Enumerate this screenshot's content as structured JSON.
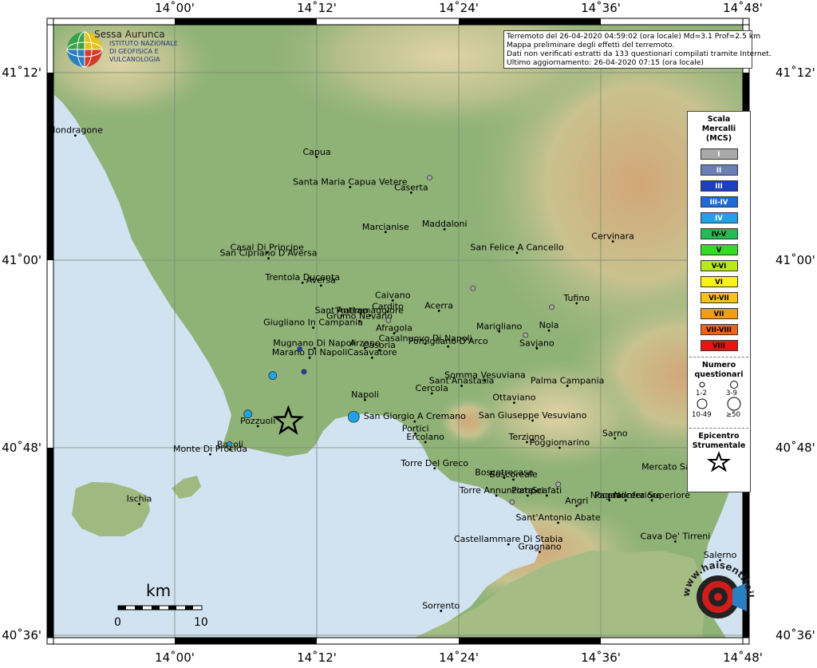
{
  "map": {
    "lon_ticks": [
      "14˚00'",
      "14˚12'",
      "14˚24'",
      "14˚36'",
      "14˚48'"
    ],
    "lat_ticks": [
      "41˚12'",
      "41˚00'",
      "40˚48'",
      "40˚36'"
    ],
    "colors": {
      "sea": "#d1e3f1",
      "lowland": "#8fb277",
      "hill": "#c3c08e",
      "mountain": "#cf9c70",
      "grid": "#7a8a7a"
    }
  },
  "logo": {
    "place": "Sessa Aurunca",
    "org_line1": "ISTITUTO NAZIONALE",
    "org_line2": "DI GEOFISICA E VULCANOLOGIA"
  },
  "info": {
    "line1": "Terremoto del 26-04-2020 04:59:02 (ora locale) Md=3.1 Prof=2.5 km",
    "line2": "Mappa preliminare degli effetti del terremoto.",
    "line3": "Dati non verificati estratti da 133 questionari compilati tramite Internet.",
    "line4": "Ultimo aggiornamento: 26-04-2020 07:15 (ora locale)"
  },
  "legend": {
    "title1": "Scala",
    "title2": "Mercalli",
    "title3": "(MCS)",
    "classes": [
      {
        "label": "I",
        "color": "#a9a9a9",
        "text": "#ffffff"
      },
      {
        "label": "II",
        "color": "#6a7fb6",
        "text": "#ffffff"
      },
      {
        "label": "III",
        "color": "#1c3fbf",
        "text": "#ffffff"
      },
      {
        "label": "III-IV",
        "color": "#1e6ad6",
        "text": "#ffffff"
      },
      {
        "label": "IV",
        "color": "#1fa3e6",
        "text": "#ffffff"
      },
      {
        "label": "IV-V",
        "color": "#22bb55",
        "text": "#000000"
      },
      {
        "label": "V",
        "color": "#33dd22",
        "text": "#000000"
      },
      {
        "label": "V-VI",
        "color": "#b8ea1a",
        "text": "#000000"
      },
      {
        "label": "VI",
        "color": "#f8f214",
        "text": "#000000"
      },
      {
        "label": "VI-VII",
        "color": "#f6c414",
        "text": "#000000"
      },
      {
        "label": "VII",
        "color": "#f59c14",
        "text": "#000000"
      },
      {
        "label": "VII-VIII",
        "color": "#f56214",
        "text": "#000000"
      },
      {
        "label": "VIII",
        "color": "#e81414",
        "text": "#000000"
      }
    ],
    "count_title1": "Numero",
    "count_title2": "questionari",
    "count_classes": [
      "1-2",
      "3-9",
      "10-49",
      "≥50"
    ],
    "epi_title1": "Epicentro",
    "epi_title2": "Strumentale"
  },
  "scale_bar": {
    "unit": "km",
    "start": "0",
    "end": "10"
  },
  "badge": {
    "text": "www.haisentitoilterremoto.it"
  },
  "places": [
    {
      "name": "Mondragone",
      "lon": 13.86,
      "lat": 41.133
    },
    {
      "name": "Capua",
      "lon": 14.2,
      "lat": 41.11
    },
    {
      "name": "Santa Maria Capua Vetere",
      "lon": 14.247,
      "lat": 41.078
    },
    {
      "name": "Caserta",
      "lon": 14.333,
      "lat": 41.072
    },
    {
      "name": "Marcianise",
      "lon": 14.297,
      "lat": 41.03
    },
    {
      "name": "Maddaloni",
      "lon": 14.38,
      "lat": 41.033
    },
    {
      "name": "San Felice A Cancello",
      "lon": 14.482,
      "lat": 41.008
    },
    {
      "name": "Cervinara",
      "lon": 14.617,
      "lat": 41.02
    },
    {
      "name": "Casal Di Principe",
      "lon": 14.13,
      "lat": 41.008
    },
    {
      "name": "San Cipriano D'Aversa",
      "lon": 14.132,
      "lat": 41.002
    },
    {
      "name": "Trentola Ducenta",
      "lon": 14.18,
      "lat": 40.976
    },
    {
      "name": "Aversa",
      "lon": 14.206,
      "lat": 40.973
    },
    {
      "name": "Caivano",
      "lon": 14.307,
      "lat": 40.957
    },
    {
      "name": "Cardito",
      "lon": 14.3,
      "lat": 40.945
    },
    {
      "name": "Sant'Antimo",
      "lon": 14.235,
      "lat": 40.941
    },
    {
      "name": "Frattamaggiore",
      "lon": 14.275,
      "lat": 40.941
    },
    {
      "name": "Grumo Nevano",
      "lon": 14.26,
      "lat": 40.935
    },
    {
      "name": "Acerra",
      "lon": 14.372,
      "lat": 40.946
    },
    {
      "name": "Tufino",
      "lon": 14.566,
      "lat": 40.954
    },
    {
      "name": "Giugliano In Campania",
      "lon": 14.195,
      "lat": 40.928
    },
    {
      "name": "Afragola",
      "lon": 14.309,
      "lat": 40.922
    },
    {
      "name": "Casalnuovo Di Napoli",
      "lon": 14.353,
      "lat": 40.911
    },
    {
      "name": "Pomigliano D'Arco",
      "lon": 14.385,
      "lat": 40.908
    },
    {
      "name": "Marigliano",
      "lon": 14.457,
      "lat": 40.924
    },
    {
      "name": "Nola",
      "lon": 14.527,
      "lat": 40.925
    },
    {
      "name": "Mugnano Di Napoli",
      "lon": 14.197,
      "lat": 40.906
    },
    {
      "name": "Arzano",
      "lon": 14.268,
      "lat": 40.906
    },
    {
      "name": "Savjano",
      "lon": 14.51,
      "lat": 40.906
    },
    {
      "name": "Marano Di Napoli",
      "lon": 14.19,
      "lat": 40.896
    },
    {
      "name": "Casavatore",
      "lon": 14.278,
      "lat": 40.896
    },
    {
      "name": "Casoria",
      "lon": 14.288,
      "lat": 40.904
    },
    {
      "name": "Somma Vesuviana",
      "lon": 14.437,
      "lat": 40.872
    },
    {
      "name": "Palma Campania",
      "lon": 14.553,
      "lat": 40.866
    },
    {
      "name": "Sant'Anastasia",
      "lon": 14.404,
      "lat": 40.866
    },
    {
      "name": "Napoli",
      "lon": 14.268,
      "lat": 40.851
    },
    {
      "name": "Cercola",
      "lon": 14.362,
      "lat": 40.858
    },
    {
      "name": "Ottaviano",
      "lon": 14.478,
      "lat": 40.848
    },
    {
      "name": "San Giorgio A Cremano",
      "lon": 14.338,
      "lat": 40.828
    },
    {
      "name": "San Giuseppe Vesuviano",
      "lon": 14.504,
      "lat": 40.829
    },
    {
      "name": "Pozzuoli",
      "lon": 14.117,
      "lat": 40.823
    },
    {
      "name": "Portici",
      "lon": 14.339,
      "lat": 40.815
    },
    {
      "name": "Ercolano",
      "lon": 14.353,
      "lat": 40.806
    },
    {
      "name": "Terzigno",
      "lon": 14.496,
      "lat": 40.806
    },
    {
      "name": "Poggiomarino",
      "lon": 14.542,
      "lat": 40.8
    },
    {
      "name": "Sarno",
      "lon": 14.62,
      "lat": 40.81
    },
    {
      "name": "Bacoli",
      "lon": 14.078,
      "lat": 40.798
    },
    {
      "name": "Monte Di Procida",
      "lon": 14.05,
      "lat": 40.793
    },
    {
      "name": "Torre Del Greco",
      "lon": 14.366,
      "lat": 40.778
    },
    {
      "name": "Mercato San Severino",
      "lon": 14.725,
      "lat": 40.774
    },
    {
      "name": "Boscotrecase",
      "lon": 14.464,
      "lat": 40.768
    },
    {
      "name": "Boscoreale",
      "lon": 14.477,
      "lat": 40.766
    },
    {
      "name": "Torre Annunziata",
      "lon": 14.453,
      "lat": 40.749
    },
    {
      "name": "Pompei",
      "lon": 14.497,
      "lat": 40.749
    },
    {
      "name": "Scafati",
      "lon": 14.524,
      "lat": 40.749
    },
    {
      "name": "Angri",
      "lon": 14.566,
      "lat": 40.738
    },
    {
      "name": "Pagani",
      "lon": 14.612,
      "lat": 40.744
    },
    {
      "name": "Nocera Inferiore",
      "lon": 14.635,
      "lat": 40.744
    },
    {
      "name": "Nocera Superiore",
      "lon": 14.672,
      "lat": 40.744
    },
    {
      "name": "Ischia",
      "lon": 13.95,
      "lat": 40.74
    },
    {
      "name": "Sant'Antonio Abate",
      "lon": 14.54,
      "lat": 40.72
    },
    {
      "name": "Castellammare Di Stabia",
      "lon": 14.47,
      "lat": 40.697
    },
    {
      "name": "Gragnano",
      "lon": 14.514,
      "lat": 40.689
    },
    {
      "name": "Cava De' Tirreni",
      "lon": 14.705,
      "lat": 40.7
    },
    {
      "name": "Salerno",
      "lon": 14.768,
      "lat": 40.68
    },
    {
      "name": "Sorrento",
      "lon": 14.375,
      "lat": 40.626
    }
  ],
  "observations": [
    {
      "lon": 14.359,
      "lat": 41.088,
      "mcs": "I",
      "count": "1-2"
    },
    {
      "lon": 14.42,
      "lat": 40.97,
      "mcs": "I",
      "count": "1-2"
    },
    {
      "lon": 14.531,
      "lat": 40.95,
      "mcs": "I",
      "count": "1-2"
    },
    {
      "lon": 14.301,
      "lat": 40.936,
      "mcs": "I",
      "count": "1-2"
    },
    {
      "lon": 14.494,
      "lat": 40.92,
      "mcs": "I",
      "count": "1-2"
    },
    {
      "lon": 14.54,
      "lat": 40.761,
      "mcs": "I",
      "count": "1-2"
    },
    {
      "lon": 14.475,
      "lat": 40.742,
      "mcs": "I",
      "count": "1-2"
    },
    {
      "lon": 14.176,
      "lat": 40.905,
      "mcs": "III",
      "count": "1-2"
    },
    {
      "lon": 14.182,
      "lat": 40.881,
      "mcs": "III",
      "count": "1-2"
    },
    {
      "lon": 14.138,
      "lat": 40.877,
      "mcs": "IV",
      "count": "3-9"
    },
    {
      "lon": 14.103,
      "lat": 40.836,
      "mcs": "IV",
      "count": "3-9"
    },
    {
      "lon": 14.252,
      "lat": 40.833,
      "mcs": "IV",
      "count": "10-49"
    },
    {
      "lon": 14.077,
      "lat": 40.804,
      "mcs": "IV",
      "count": "1-2"
    }
  ],
  "epicenter": {
    "lon": 14.16,
    "lat": 40.828
  }
}
